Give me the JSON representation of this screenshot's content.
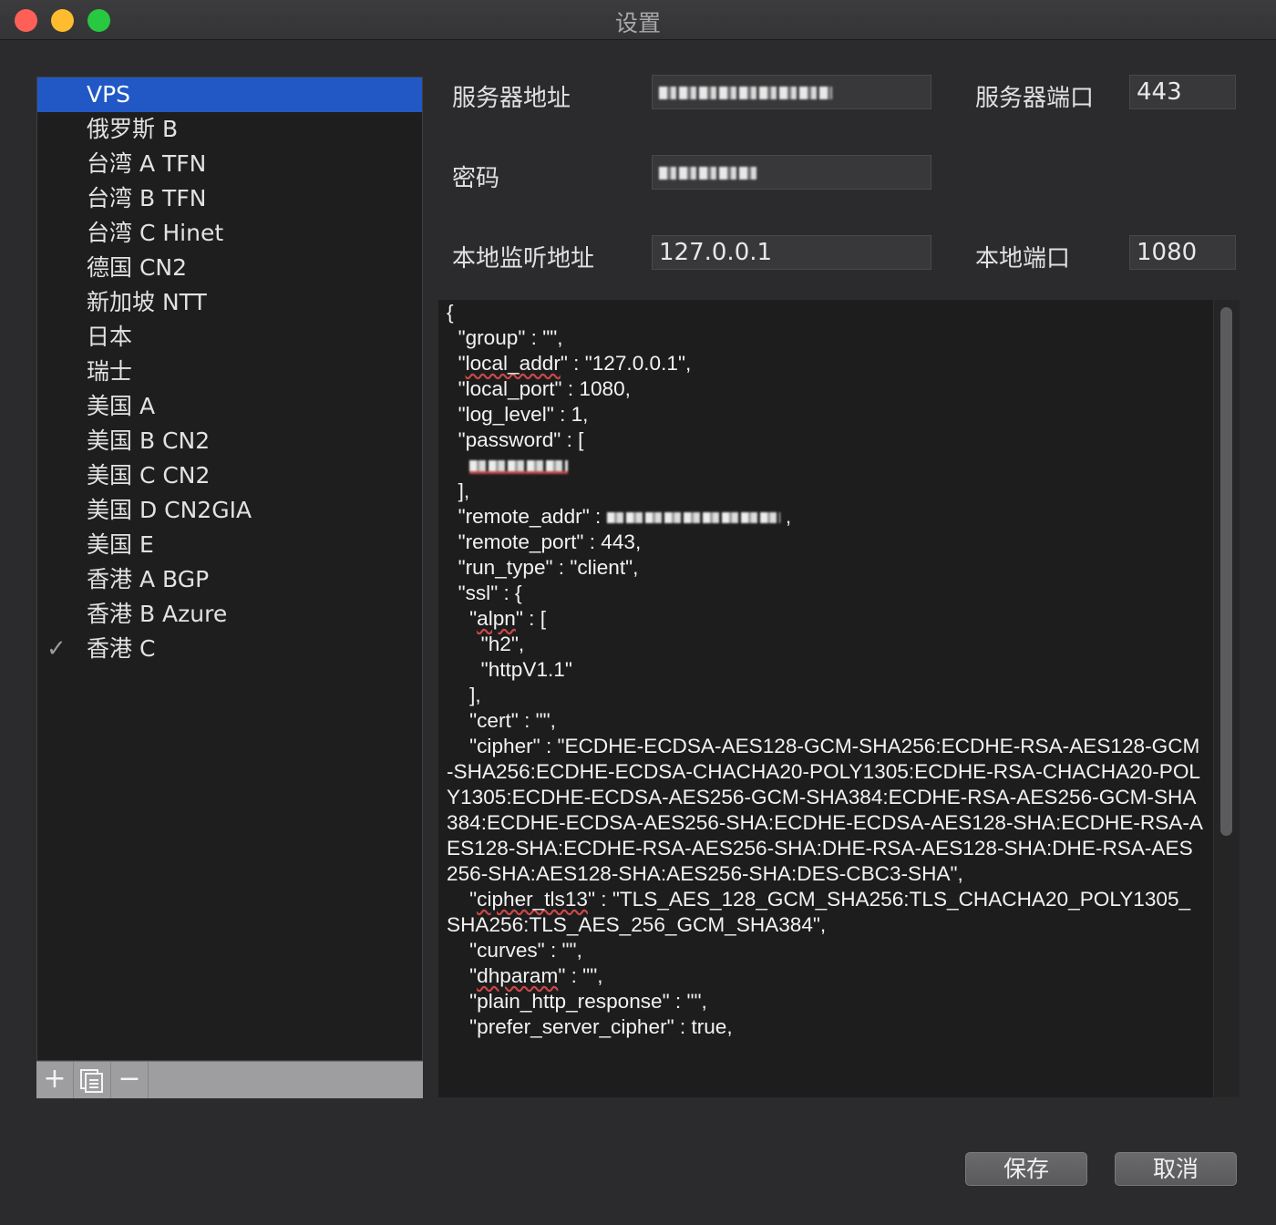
{
  "window": {
    "title": "设置"
  },
  "sidebar": {
    "items": [
      {
        "label": "VPS",
        "selected": true,
        "checked": false
      },
      {
        "label": "俄罗斯 B",
        "selected": false,
        "checked": false
      },
      {
        "label": "台湾 A TFN",
        "selected": false,
        "checked": false
      },
      {
        "label": "台湾 B TFN",
        "selected": false,
        "checked": false
      },
      {
        "label": "台湾 C Hinet",
        "selected": false,
        "checked": false
      },
      {
        "label": "德国 CN2",
        "selected": false,
        "checked": false
      },
      {
        "label": "新加坡 NTT",
        "selected": false,
        "checked": false
      },
      {
        "label": "日本",
        "selected": false,
        "checked": false
      },
      {
        "label": "瑞士",
        "selected": false,
        "checked": false
      },
      {
        "label": "美国 A",
        "selected": false,
        "checked": false
      },
      {
        "label": "美国 B CN2",
        "selected": false,
        "checked": false
      },
      {
        "label": "美国 C CN2",
        "selected": false,
        "checked": false
      },
      {
        "label": "美国 D CN2GIA",
        "selected": false,
        "checked": false
      },
      {
        "label": "美国 E",
        "selected": false,
        "checked": false
      },
      {
        "label": "香港 A BGP",
        "selected": false,
        "checked": false
      },
      {
        "label": "香港 B Azure",
        "selected": false,
        "checked": false
      },
      {
        "label": "香港 C",
        "selected": false,
        "checked": true
      }
    ],
    "check_glyph": "✓",
    "toolbar": {
      "add": "+",
      "duplicate_icon": "duplicate-icon",
      "remove": "−"
    }
  },
  "form": {
    "server_address_label": "服务器地址",
    "server_address_value": "",
    "server_port_label": "服务器端口",
    "server_port_value": "443",
    "password_label": "密码",
    "password_value": "",
    "local_address_label": "本地监听地址",
    "local_address_value": "127.0.0.1",
    "local_port_label": "本地端口",
    "local_port_value": "1080"
  },
  "config_lines": [
    "{",
    "  \"group\" : \"\",",
    "  \"local_addr\" : \"127.0.0.1\",",
    "  \"local_port\" : 1080,",
    "  \"log_level\" : 1,",
    "  \"password\" : [",
    "",
    "  ],",
    "  \"remote_addr\" : ",
    "  \"remote_port\" : 443,",
    "  \"run_type\" : \"client\",",
    "  \"ssl\" : {",
    "    \"alpn\" : [",
    "      \"h2\",",
    "      \"httpV1.1\"",
    "    ],",
    "    \"cert\" : \"\",",
    "    \"cipher\" : \"ECDHE-ECDSA-AES128-GCM-SHA256:ECDHE-RSA-AES128-GCM-SHA256:ECDHE-ECDSA-CHACHA20-POLY1305:ECDHE-RSA-CHACHA20-POLY1305:ECDHE-ECDSA-AES256-GCM-SHA384:ECDHE-RSA-AES256-GCM-SHA384:ECDHE-ECDSA-AES256-SHA:ECDHE-ECDSA-AES128-SHA:ECDHE-RSA-AES128-SHA:ECDHE-RSA-AES256-SHA:DHE-RSA-AES128-SHA:DHE-RSA-AES256-SHA:AES128-SHA:AES256-SHA:DES-CBC3-SHA\",",
    "    \"cipher_tls13\" : \"TLS_AES_128_GCM_SHA256:TLS_CHACHA20_POLY1305_SHA256:TLS_AES_256_GCM_SHA384\",",
    "    \"curves\" : \"\",",
    "    \"dhparam\" : \"\",",
    "    \"plain_http_response\" : \"\",",
    "    \"prefer_server_cipher\" : true,"
  ],
  "buttons": {
    "save": "保存",
    "cancel": "取消"
  }
}
